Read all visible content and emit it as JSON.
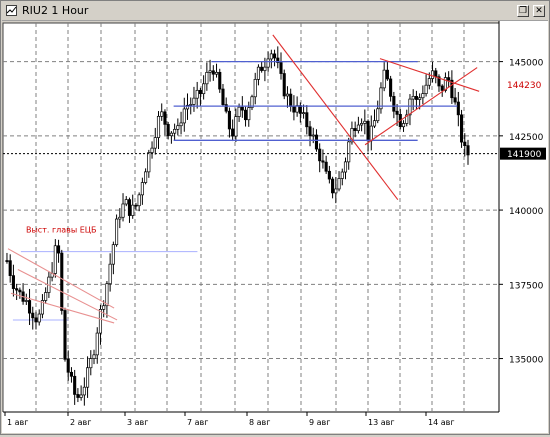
{
  "window": {
    "title": "RIU2 1 Hour",
    "restore_glyph": "❐",
    "close_glyph": "✕"
  },
  "colors": {
    "candle": "#000000",
    "bull_fill": "#ffffff",
    "bear_fill": "#000000",
    "grid": "#808080",
    "channel": "#5060d0",
    "trend": "#e03030",
    "annotation": "#cc0000"
  },
  "chart_data": {
    "type": "candlestick",
    "title": "RIU2 1 Hour",
    "x_ticks": [
      "1 авг",
      "2 авг",
      "3 авг",
      "7 авг",
      "8 авг",
      "9 авг",
      "13 авг",
      "14 авг"
    ],
    "y_ticks": [
      135000,
      137500,
      140000,
      142500,
      145000
    ],
    "ylim": [
      133200,
      146300
    ],
    "price_labels": [
      {
        "value": 144230,
        "text": "144230",
        "style": "red"
      },
      {
        "value": 141900,
        "text": "141900",
        "style": "black"
      }
    ],
    "annotation": "Выст. главы ЕЦБ",
    "channel_lines": [
      {
        "x1": 210,
        "x2": 418,
        "y": 145000
      },
      {
        "x1": 172,
        "x2": 458,
        "y": 143500
      },
      {
        "x1": 172,
        "x2": 418,
        "y": 142350
      }
    ],
    "trend_lines": [
      {
        "x1": 272,
        "x2": 398,
        "y1": 145900,
        "y2": 140350
      },
      {
        "x1": 380,
        "x2": 480,
        "y1": 145100,
        "y2": 144000
      },
      {
        "x1": 365,
        "x2": 478,
        "y1": 142200,
        "y2": 144800
      },
      {
        "x1": 5,
        "x2": 112,
        "y1": 138700,
        "y2": 136700
      },
      {
        "x1": 15,
        "x2": 115,
        "y1": 138000,
        "y2": 136300
      },
      {
        "x1": 8,
        "x2": 112,
        "y1": 137200,
        "y2": 136200
      }
    ],
    "thin_lines": [
      {
        "x1": 18,
        "x2": 196,
        "y": 138600
      },
      {
        "x1": 10,
        "x2": 66,
        "y": 136300
      }
    ],
    "anchors": [
      [
        4,
        138300
      ],
      [
        10,
        137600
      ],
      [
        16,
        137200
      ],
      [
        22,
        137000
      ],
      [
        26,
        136800
      ],
      [
        31,
        136500
      ],
      [
        35,
        136300
      ],
      [
        39,
        136600
      ],
      [
        43,
        137200
      ],
      [
        47,
        137700
      ],
      [
        51,
        138300
      ],
      [
        55,
        139000
      ],
      [
        58,
        137500
      ],
      [
        61,
        135200
      ],
      [
        64,
        134800
      ],
      [
        68,
        134300
      ],
      [
        72,
        133800
      ],
      [
        76,
        133700
      ],
      [
        80,
        134000
      ],
      [
        84,
        134300
      ],
      [
        88,
        134800
      ],
      [
        92,
        135400
      ],
      [
        96,
        136200
      ],
      [
        100,
        136800
      ],
      [
        104,
        137400
      ],
      [
        108,
        138200
      ],
      [
        112,
        139000
      ],
      [
        116,
        139800
      ],
      [
        120,
        140100
      ],
      [
        124,
        140200
      ],
      [
        128,
        140000
      ],
      [
        132,
        140000
      ],
      [
        136,
        140300
      ],
      [
        140,
        141000
      ],
      [
        144,
        141500
      ],
      [
        148,
        142000
      ],
      [
        152,
        142500
      ],
      [
        156,
        143000
      ],
      [
        160,
        143200
      ],
      [
        164,
        142900
      ],
      [
        168,
        142600
      ],
      [
        172,
        142800
      ],
      [
        176,
        142600
      ],
      [
        180,
        143200
      ],
      [
        184,
        143500
      ],
      [
        188,
        143600
      ],
      [
        192,
        143600
      ],
      [
        196,
        143800
      ],
      [
        200,
        144000
      ],
      [
        204,
        144400
      ],
      [
        208,
        144700
      ],
      [
        212,
        144800
      ],
      [
        216,
        144300
      ],
      [
        220,
        143800
      ],
      [
        224,
        143200
      ],
      [
        228,
        142800
      ],
      [
        232,
        142600
      ],
      [
        236,
        143100
      ],
      [
        240,
        143500
      ],
      [
        244,
        143200
      ],
      [
        248,
        143600
      ],
      [
        252,
        144000
      ],
      [
        256,
        144500
      ],
      [
        260,
        144800
      ],
      [
        264,
        145000
      ],
      [
        268,
        145400
      ],
      [
        272,
        145300
      ],
      [
        276,
        144900
      ],
      [
        280,
        144400
      ],
      [
        284,
        144000
      ],
      [
        288,
        143700
      ],
      [
        292,
        143500
      ],
      [
        296,
        143400
      ],
      [
        300,
        143200
      ],
      [
        304,
        143000
      ],
      [
        308,
        142800
      ],
      [
        312,
        142500
      ],
      [
        316,
        142000
      ],
      [
        320,
        141800
      ],
      [
        324,
        141300
      ],
      [
        328,
        140900
      ],
      [
        332,
        140700
      ],
      [
        336,
        140800
      ],
      [
        340,
        141100
      ],
      [
        344,
        141500
      ],
      [
        348,
        142200
      ],
      [
        352,
        142700
      ],
      [
        356,
        143000
      ],
      [
        360,
        143200
      ],
      [
        364,
        143000
      ],
      [
        368,
        142500
      ],
      [
        372,
        142600
      ],
      [
        376,
        143200
      ],
      [
        380,
        143900
      ],
      [
        384,
        144500
      ],
      [
        388,
        144300
      ],
      [
        392,
        143800
      ],
      [
        396,
        143300
      ],
      [
        400,
        143000
      ],
      [
        404,
        143100
      ],
      [
        408,
        143500
      ],
      [
        412,
        144000
      ],
      [
        416,
        143600
      ],
      [
        420,
        143800
      ],
      [
        424,
        144100
      ],
      [
        428,
        144300
      ],
      [
        432,
        144600
      ],
      [
        436,
        144400
      ],
      [
        440,
        144000
      ],
      [
        444,
        144200
      ],
      [
        448,
        144500
      ],
      [
        452,
        144100
      ],
      [
        456,
        143500
      ],
      [
        460,
        142800
      ],
      [
        463,
        142300
      ],
      [
        466,
        141900
      ],
      [
        469,
        141900
      ]
    ]
  }
}
